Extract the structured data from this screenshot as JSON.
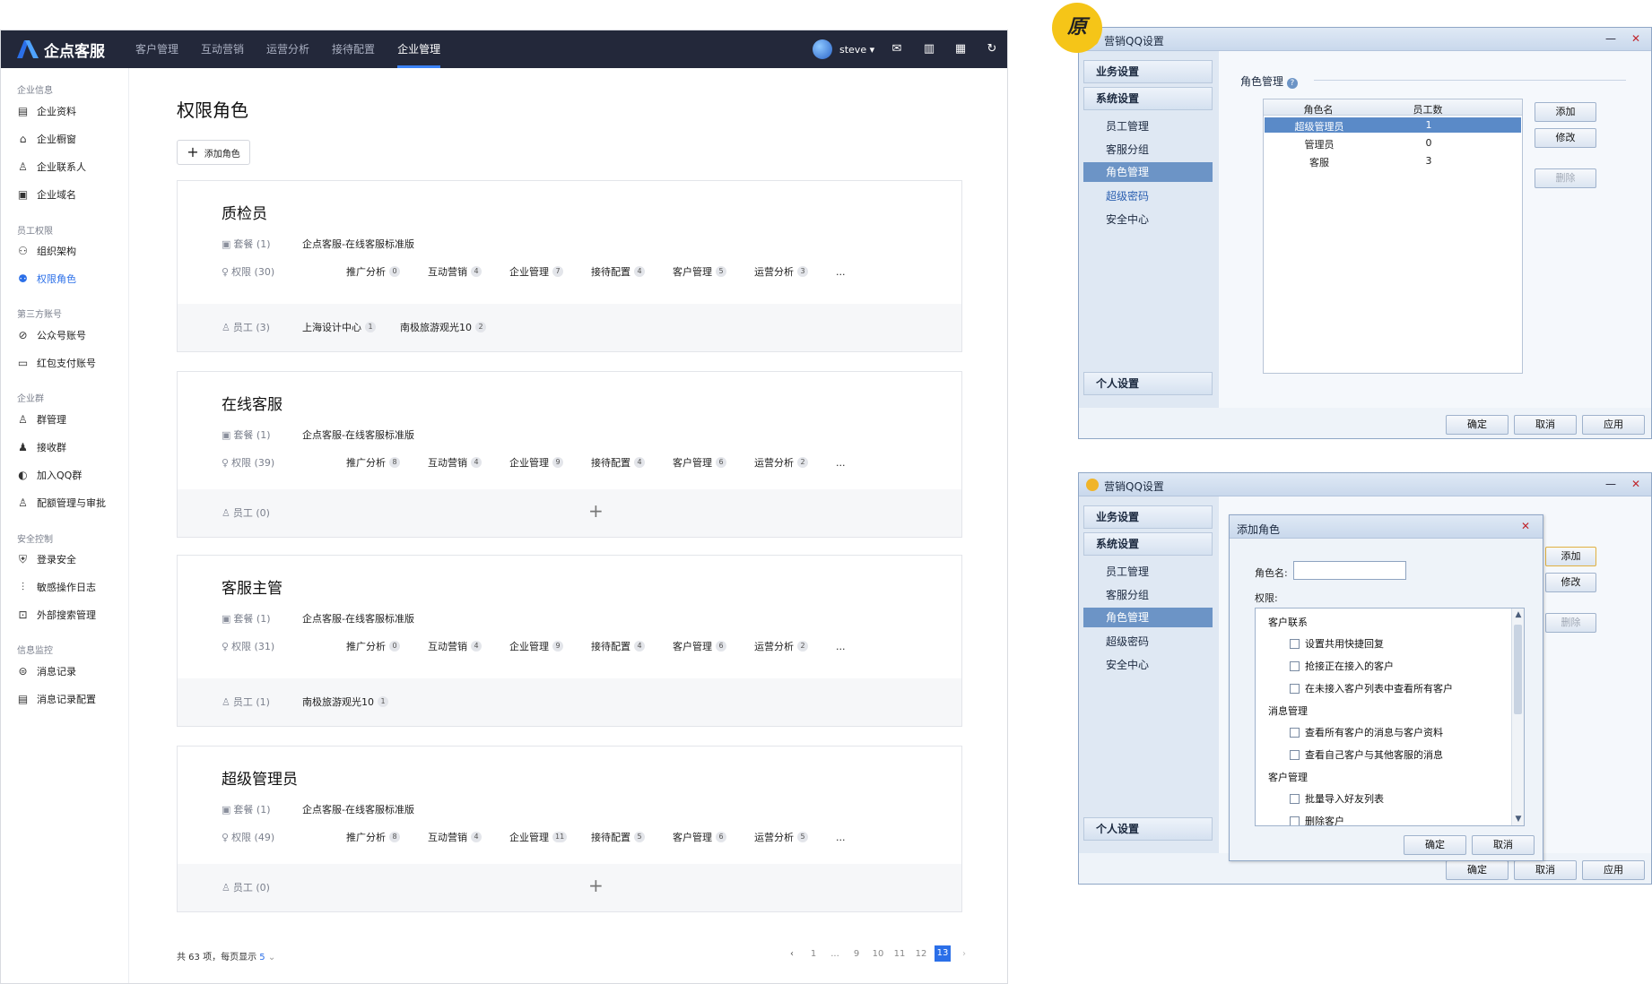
{
  "app": {
    "logo_text": "企点客服",
    "nav": [
      "客户管理",
      "互动营销",
      "运营分析",
      "接待配置",
      "企业管理"
    ],
    "nav_active": 4,
    "user": "steve ▾",
    "brand_color": "#23283a",
    "accent": "#2b6fe8"
  },
  "sidebar": {
    "groups": [
      {
        "title": "企业信息",
        "items": [
          {
            "label": "企业资料",
            "icon": "document-icon"
          },
          {
            "label": "企业橱窗",
            "icon": "storefront-icon"
          },
          {
            "label": "企业联系人",
            "icon": "contact-icon"
          },
          {
            "label": "企业域名",
            "icon": "domain-icon"
          }
        ]
      },
      {
        "title": "员工权限",
        "items": [
          {
            "label": "组织架构",
            "icon": "org-chart-icon"
          },
          {
            "label": "权限角色",
            "icon": "role-icon",
            "active": true
          }
        ]
      },
      {
        "title": "第三方账号",
        "items": [
          {
            "label": "公众号账号",
            "icon": "official-account-icon"
          },
          {
            "label": "红包支付账号",
            "icon": "wallet-icon"
          }
        ]
      },
      {
        "title": "企业群",
        "items": [
          {
            "label": "群管理",
            "icon": "group-icon"
          },
          {
            "label": "接收群",
            "icon": "receive-group-icon"
          },
          {
            "label": "加入QQ群",
            "icon": "join-group-icon"
          },
          {
            "label": "配额管理与审批",
            "icon": "quota-icon"
          }
        ]
      },
      {
        "title": "安全控制",
        "items": [
          {
            "label": "登录安全",
            "icon": "shield-icon"
          },
          {
            "label": "敏感操作日志",
            "icon": "sliders-icon"
          },
          {
            "label": "外部搜索管理",
            "icon": "search-manage-icon"
          }
        ]
      },
      {
        "title": "信息监控",
        "items": [
          {
            "label": "消息记录",
            "icon": "message-record-icon"
          },
          {
            "label": "消息记录配置",
            "icon": "message-config-icon"
          }
        ]
      }
    ]
  },
  "main": {
    "title": "权限角色",
    "add_role": "添加角色",
    "package_label": "套餐 (1)",
    "package_value": "企点客服-在线客服标准版",
    "roles": [
      {
        "name": "质检员",
        "perm_label": "权限 (30)",
        "perms": [
          [
            "推广分析",
            "0"
          ],
          [
            "互动营销",
            "4"
          ],
          [
            "企业管理",
            "7"
          ],
          [
            "接待配置",
            "4"
          ],
          [
            "客户管理",
            "5"
          ],
          [
            "运营分析",
            "3"
          ]
        ],
        "staff_label": "员工 (3)",
        "staff": [
          [
            "上海设计中心",
            "1"
          ],
          [
            "南极旅游观光10",
            "2"
          ]
        ]
      },
      {
        "name": "在线客服",
        "perm_label": "权限 (39)",
        "perms": [
          [
            "推广分析",
            "8"
          ],
          [
            "互动营销",
            "4"
          ],
          [
            "企业管理",
            "9"
          ],
          [
            "接待配置",
            "4"
          ],
          [
            "客户管理",
            "6"
          ],
          [
            "运营分析",
            "2"
          ]
        ],
        "staff_label": "员工 (0)",
        "staff": []
      },
      {
        "name": "客服主管",
        "perm_label": "权限 (31)",
        "perms": [
          [
            "推广分析",
            "0"
          ],
          [
            "互动营销",
            "4"
          ],
          [
            "企业管理",
            "9"
          ],
          [
            "接待配置",
            "4"
          ],
          [
            "客户管理",
            "6"
          ],
          [
            "运营分析",
            "2"
          ]
        ],
        "staff_label": "员工 (1)",
        "staff": [
          [
            "南极旅游观光10",
            "1"
          ]
        ]
      },
      {
        "name": "超级管理员",
        "perm_label": "权限 (49)",
        "perms": [
          [
            "推广分析",
            "8"
          ],
          [
            "互动营销",
            "4"
          ],
          [
            "企业管理",
            "11"
          ],
          [
            "接待配置",
            "5"
          ],
          [
            "客户管理",
            "6"
          ],
          [
            "运营分析",
            "5"
          ]
        ],
        "staff_label": "员工 (0)",
        "staff": []
      }
    ],
    "more": "...",
    "pager_total": "共 63 项，每页显示",
    "pager_size": "5",
    "pages": [
      "1",
      "...",
      "9",
      "10",
      "11",
      "12",
      "13"
    ],
    "current_page": "13"
  },
  "legacy": {
    "badge": "原",
    "win_title": "营销QQ设置",
    "nav": {
      "business": "业务设置",
      "system": "系统设置",
      "subs": [
        "员工管理",
        "客服分组",
        "角色管理",
        "超级密码",
        "安全中心"
      ],
      "personal": "个人设置"
    },
    "role_section": "角色管理",
    "table_headers": [
      "角色名",
      "员工数"
    ],
    "table_rows": [
      [
        "超级管理员",
        "1"
      ],
      [
        "管理员",
        "0"
      ],
      [
        "客服",
        "3"
      ]
    ],
    "btn_add": "添加",
    "btn_edit": "修改",
    "btn_delete": "删除",
    "btn_ok": "确定",
    "btn_cancel": "取消",
    "btn_apply": "应用",
    "modal": {
      "title": "添加角色",
      "name_label": "角色名:",
      "perm_label": "权限:",
      "groups": [
        {
          "title": "客户联系",
          "items": [
            "设置共用快捷回复",
            "抢接正在接入的客户",
            "在未接入客户列表中查看所有客户"
          ]
        },
        {
          "title": "消息管理",
          "items": [
            "查看所有客户的消息与客户资料",
            "查看自己客户与其他客服的消息"
          ]
        },
        {
          "title": "客户管理",
          "items": [
            "批量导入好友列表",
            "删除客户"
          ]
        }
      ],
      "ok": "确定",
      "cancel": "取消"
    }
  }
}
